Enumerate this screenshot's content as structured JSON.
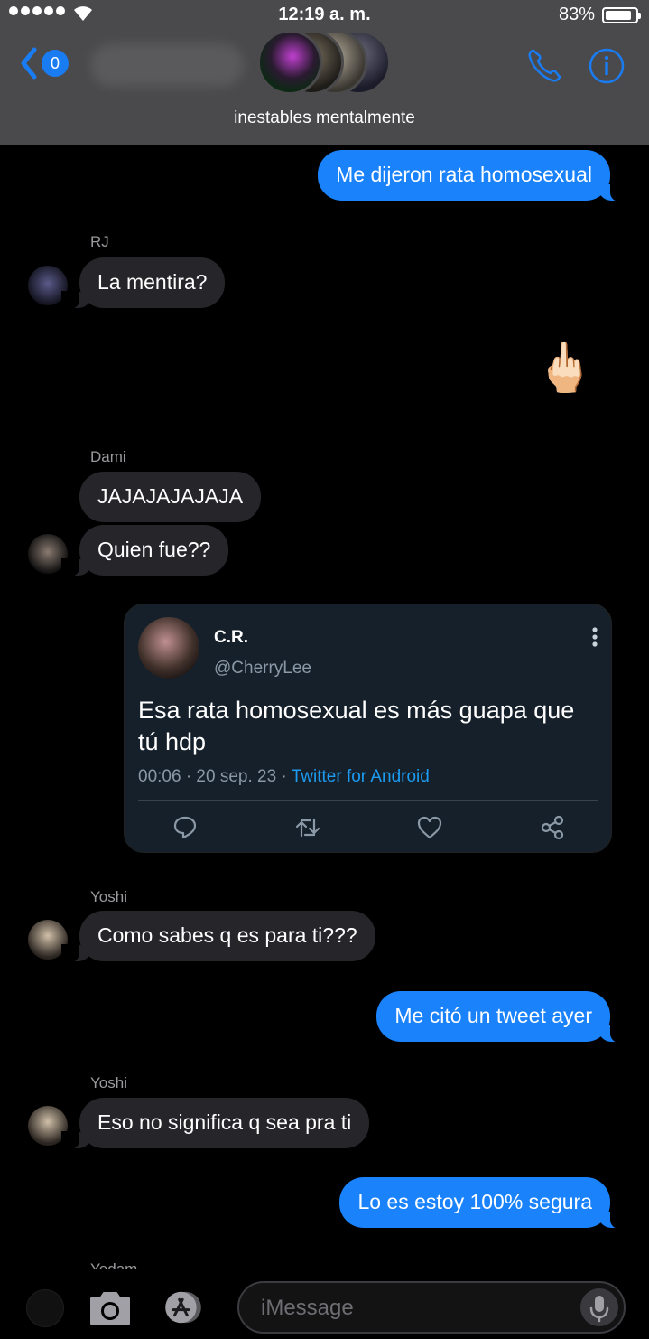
{
  "status_bar": {
    "time": "12:19 a. m.",
    "battery": "83%"
  },
  "header": {
    "back_badge": "0",
    "title": "inestables mentalmente"
  },
  "icons": {
    "back": "chevron-left-icon",
    "call": "phone-icon",
    "info": "info-icon"
  },
  "accent_color": "#1a82fb",
  "messages": {
    "m1": "Me dijeron rata homosexual",
    "rj_name": "RJ",
    "m2": "La mentira?",
    "m3_emoji": "🖕🏻",
    "dami_name": "Dami",
    "m4": "JAJAJAJAJAJA",
    "m5": "Quien fue??",
    "yoshi1_name": "Yoshi",
    "m6": "Como sabes q es para ti???",
    "m7": "Me citó un tweet ayer",
    "yoshi2_name": "Yoshi",
    "m8": "Eso no significa q sea pra ti",
    "m9": "Lo es estoy 100% segura",
    "yedam_name": "Yedam"
  },
  "tweet": {
    "name": "C.R.",
    "handle": "@CherryLee",
    "text": "Esa rata homosexual es más guapa que tú hdp",
    "meta_time": "00:06 · 20 sep. 23 · ",
    "meta_source": "Twitter for Android"
  },
  "composer": {
    "placeholder": "iMessage"
  }
}
